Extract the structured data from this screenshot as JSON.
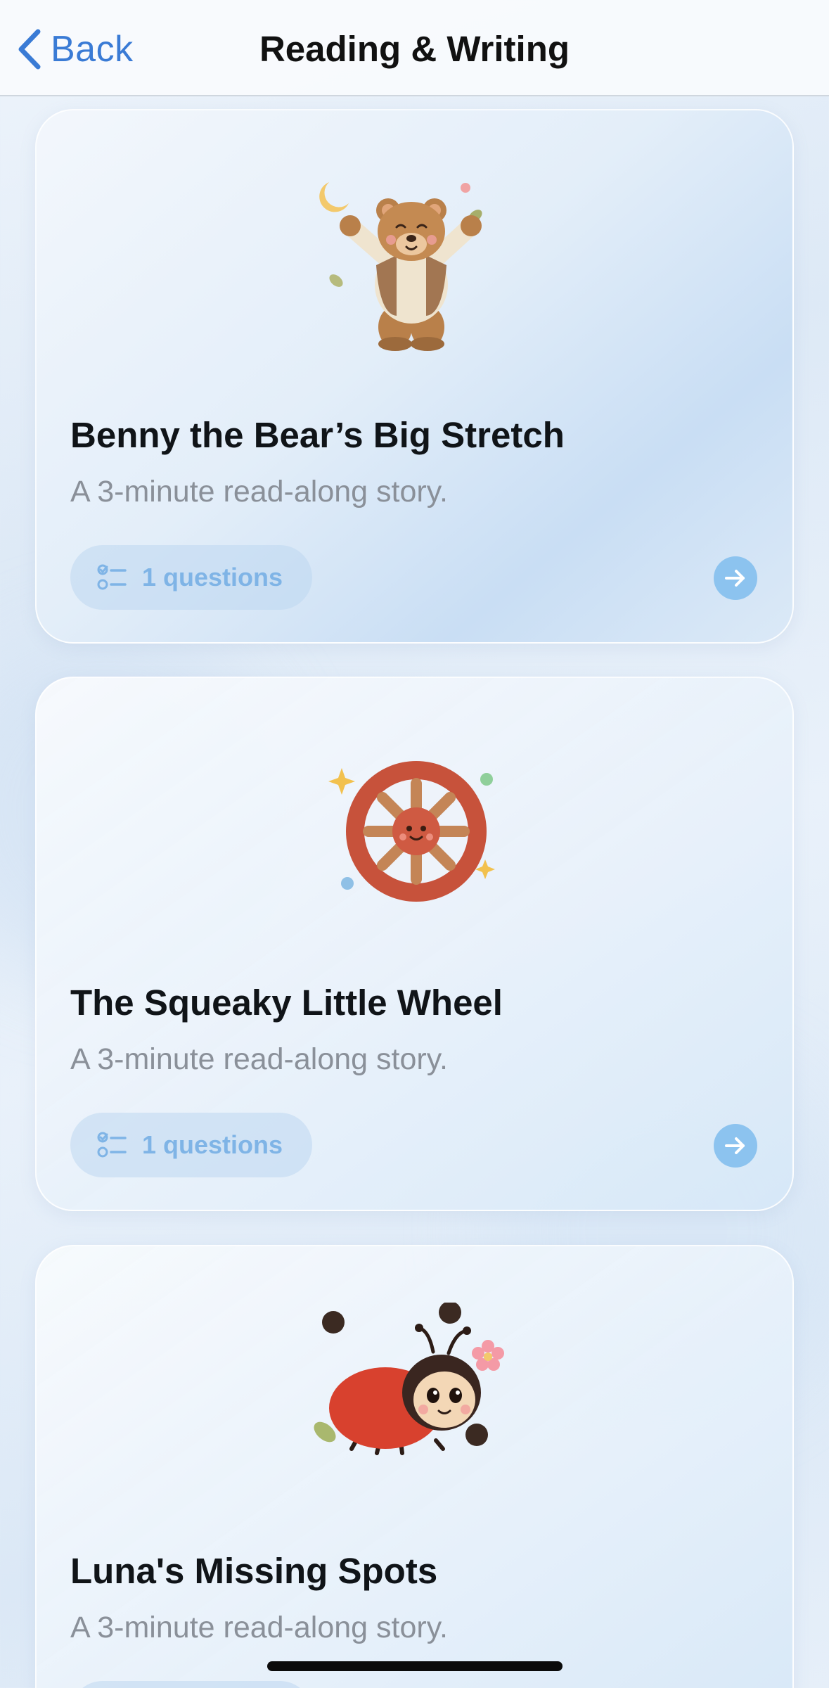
{
  "nav": {
    "back_label": "Back",
    "title": "Reading & Writing"
  },
  "stories": [
    {
      "icon": "bear-icon",
      "title": "Benny the Bear’s Big Stretch",
      "subtitle": "A 3-minute read-along story.",
      "questions_label": "1 questions"
    },
    {
      "icon": "wheel-icon",
      "title": "The Squeaky Little Wheel",
      "subtitle": "A 3-minute read-along story.",
      "questions_label": "1 questions"
    },
    {
      "icon": "ladybug-icon",
      "title": "Luna's Missing Spots",
      "subtitle": "A 3-minute read-along story.",
      "questions_label": ""
    }
  ],
  "colors": {
    "accent": "#3a7bd5",
    "pill_text": "#7fb4e6",
    "go_button": "#8cc3ef"
  }
}
